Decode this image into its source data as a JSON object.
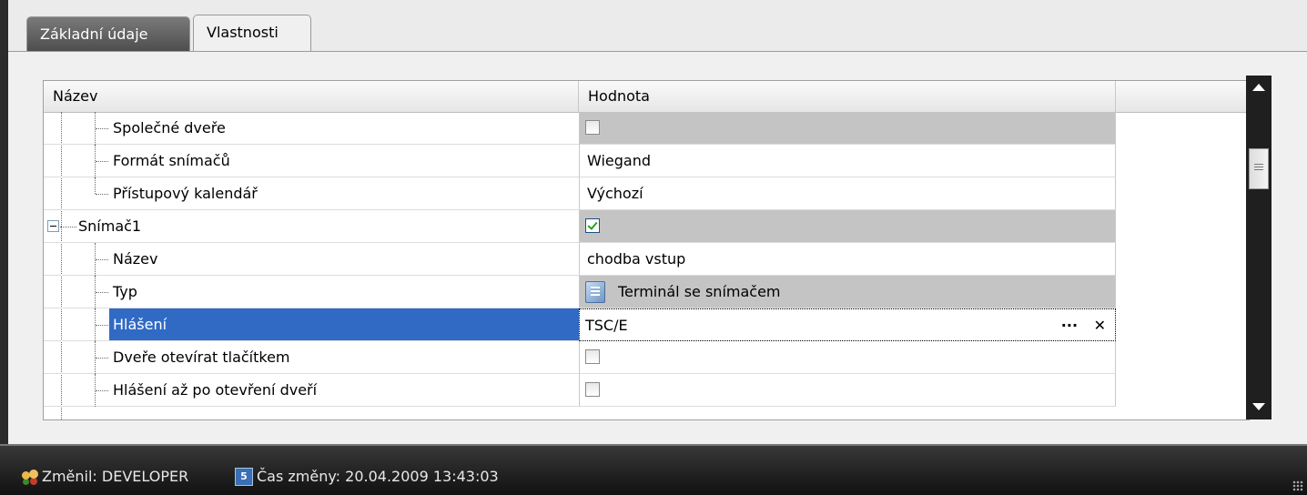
{
  "tabs": [
    {
      "label": "Základní údaje",
      "active": false
    },
    {
      "label": "Vlastnosti",
      "active": true
    }
  ],
  "grid": {
    "columns": [
      "Název",
      "Hodnota"
    ],
    "rows": [
      {
        "label": "Společné dveře",
        "value_type": "checkbox",
        "checked": false,
        "value": ""
      },
      {
        "label": "Formát snímačů",
        "value_type": "text",
        "value": "Wiegand"
      },
      {
        "label": "Přístupový kalendář",
        "value_type": "text",
        "value": "Výchozí"
      },
      {
        "label": "Snímač1",
        "value_type": "checkbox",
        "checked": true,
        "expanded": true,
        "value": ""
      },
      {
        "label": "Název",
        "value_type": "text",
        "value": "chodba vstup"
      },
      {
        "label": "Typ",
        "value_type": "icon-text",
        "icon": "terminal-icon",
        "value": "Terminál se snímačem"
      },
      {
        "label": "Hlášení",
        "value_type": "edit",
        "value": "TSC/E",
        "selected": true
      },
      {
        "label": "Dveře otevírat tlačítkem",
        "value_type": "checkbox",
        "checked": false,
        "value": ""
      },
      {
        "label": "Hlášení až po otevření dveří",
        "value_type": "checkbox",
        "checked": false,
        "value": ""
      }
    ],
    "edit_buttons": {
      "ellipsis": "···",
      "clear": "✕"
    }
  },
  "statusbar": {
    "changed_by": "Změnil: DEVELOPER",
    "change_time": "Čas změny: 20.04.2009 13:43:03",
    "calendar_icon_text": "5"
  },
  "colors": {
    "selection": "#316ac5",
    "gray_cell": "#c4c4c4",
    "statusbar": "#1f1f1f"
  }
}
